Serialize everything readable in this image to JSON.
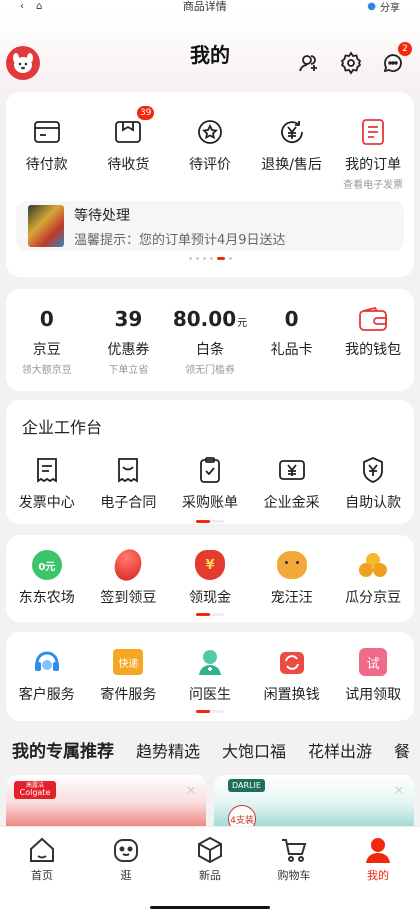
{
  "statusbar": {
    "page_title": "商品详情",
    "share": "分享"
  },
  "header": {
    "title": "我的",
    "message_badge": "2"
  },
  "orders": {
    "items": [
      {
        "label": "待付款",
        "icon": "wallet-card-icon"
      },
      {
        "label": "待收货",
        "icon": "package-icon",
        "badge": "39"
      },
      {
        "label": "待评价",
        "icon": "star-badge-icon"
      },
      {
        "label": "退换/售后",
        "icon": "yen-refund-icon"
      },
      {
        "label": "我的订单",
        "sub": "查看电子发票",
        "icon": "order-doc-icon"
      }
    ],
    "pending": {
      "title": "等待处理",
      "text": "温馨提示：您的订单预计4月9日送达"
    }
  },
  "wallet": {
    "items": [
      {
        "value": "0",
        "unit": "",
        "label": "京豆",
        "sub": "领大额京豆"
      },
      {
        "value": "39",
        "unit": "",
        "label": "优惠券",
        "sub": "下单立省"
      },
      {
        "value": "80.00",
        "unit": "元",
        "label": "白条",
        "sub": "领无门槛券"
      },
      {
        "value": "0",
        "unit": "",
        "label": "礼品卡",
        "sub": ""
      },
      {
        "value": "",
        "unit": "",
        "label": "我的钱包",
        "sub": ""
      }
    ]
  },
  "enterprise": {
    "title": "企业工作台",
    "items": [
      {
        "label": "发票中心"
      },
      {
        "label": "电子合同"
      },
      {
        "label": "采购账单"
      },
      {
        "label": "企业金采"
      },
      {
        "label": "自助认款"
      }
    ]
  },
  "fun": {
    "items": [
      {
        "label": "东东农场",
        "icon_text": "0元"
      },
      {
        "label": "签到领豆"
      },
      {
        "label": "领现金"
      },
      {
        "label": "宠汪汪"
      },
      {
        "label": "瓜分京豆"
      }
    ]
  },
  "services": {
    "items": [
      {
        "label": "客户服务"
      },
      {
        "label": "寄件服务",
        "icon_text": "快递"
      },
      {
        "label": "问医生"
      },
      {
        "label": "闲置换钱"
      },
      {
        "label": "试用领取",
        "icon_text": "试"
      }
    ]
  },
  "recommend": {
    "tabs": [
      "我的专属推荐",
      "趋势精选",
      "大饱口福",
      "花样出游",
      "餐"
    ],
    "cards": [
      {
        "brand": "Colgate",
        "brand_sub": "高露洁"
      },
      {
        "brand": "DARLIE",
        "tag": "4支装"
      }
    ]
  },
  "tabbar": {
    "items": [
      {
        "label": "首页"
      },
      {
        "label": "逛"
      },
      {
        "label": "新品"
      },
      {
        "label": "购物车"
      },
      {
        "label": "我的"
      }
    ]
  },
  "colors": {
    "accent": "#f2270c",
    "brand": "#e4393c"
  }
}
